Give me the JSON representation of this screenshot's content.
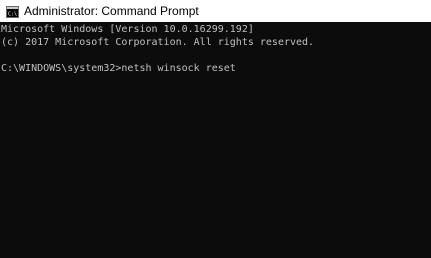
{
  "window": {
    "title": "Administrator: Command Prompt",
    "icon": "cmd-icon"
  },
  "console": {
    "lines": [
      "Microsoft Windows [Version 10.0.16299.192]",
      "(c) 2017 Microsoft Corporation. All rights reserved.",
      "C:\\WINDOWS\\system32>netsh winsock reset"
    ],
    "text_color": "#c0c0c0",
    "background_color": "#0c0c0c"
  }
}
